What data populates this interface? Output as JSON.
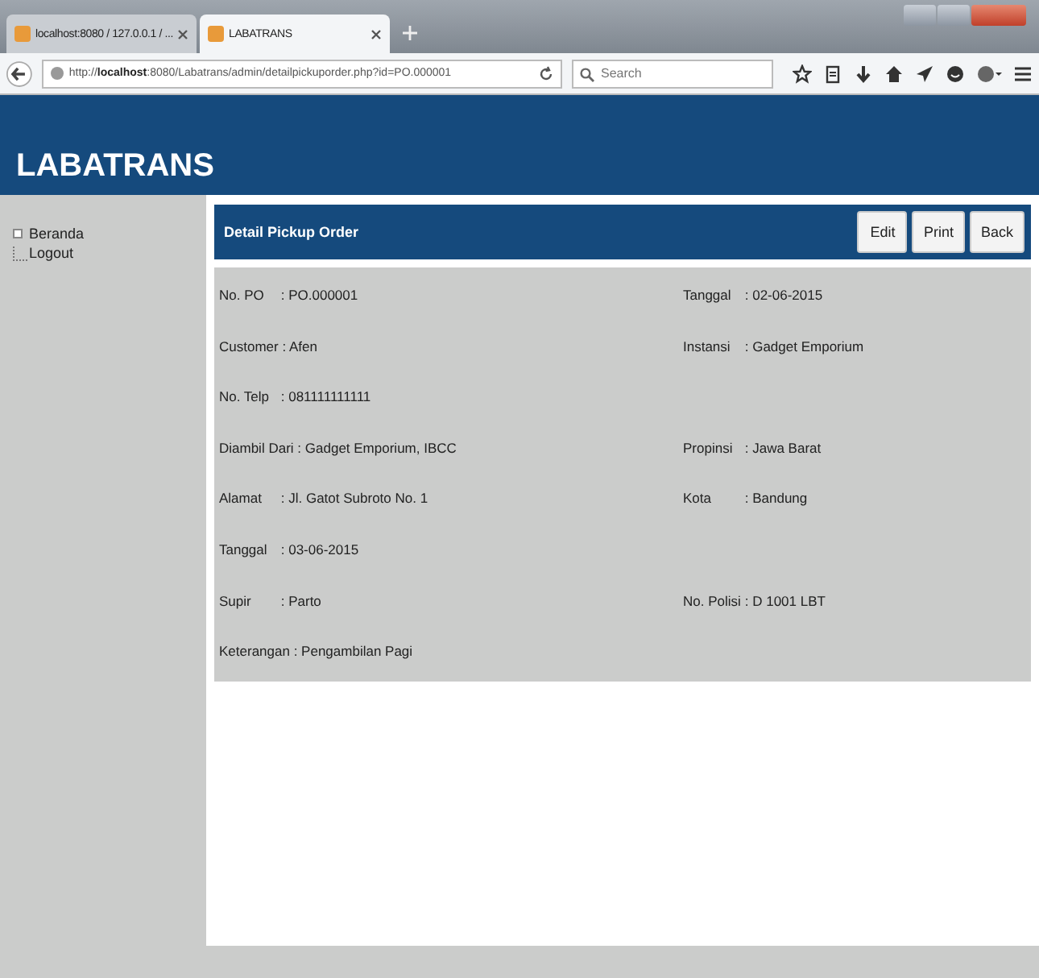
{
  "browser": {
    "tabs": [
      {
        "title": "localhost:8080 / 127.0.0.1 / ...",
        "selected": false
      },
      {
        "title": "LABATRANS",
        "selected": true
      }
    ],
    "url_prefix": "http://",
    "url_host": "localhost",
    "url_rest": ":8080/Labatrans/admin/detailpickuporder.php?id=PO.000001",
    "search_placeholder": "Search"
  },
  "site_title": "LABATRANS",
  "sidebar": {
    "items": [
      {
        "label": "Beranda"
      },
      {
        "label": "Logout"
      }
    ]
  },
  "panel": {
    "title": "Detail Pickup Order",
    "buttons": [
      "Edit",
      "Print",
      "Back"
    ],
    "rows": [
      {
        "left": {
          "label": "No. PO",
          "value": ": PO.000001"
        },
        "right": {
          "label": "Tanggal",
          "value": ": 02-06-2015"
        }
      },
      {
        "left": {
          "label": "Customer",
          "value": ": Afen"
        },
        "right": {
          "label": "Instansi",
          "value": ": Gadget Emporium"
        }
      },
      {
        "left": {
          "label": "No. Telp",
          "value": ": 081111111111"
        }
      },
      {
        "left": {
          "label": "Diambil Dari",
          "value": ": Gadget Emporium, IBCC"
        },
        "right": {
          "label": "Propinsi",
          "value": ": Jawa Barat"
        }
      },
      {
        "left": {
          "label": "Alamat",
          "value": ": Jl. Gatot Subroto No. 1"
        },
        "right": {
          "label": "Kota",
          "value": ": Bandung"
        }
      },
      {
        "left": {
          "label": "Tanggal",
          "value": ": 03-06-2015"
        }
      },
      {
        "left": {
          "label": "Supir",
          "value": ": Parto"
        },
        "right": {
          "label": "No. Polisi",
          "value": ": D 1001 LBT"
        }
      },
      {
        "left": {
          "label": "Keterangan",
          "value": ": Pengambilan Pagi"
        }
      }
    ]
  }
}
